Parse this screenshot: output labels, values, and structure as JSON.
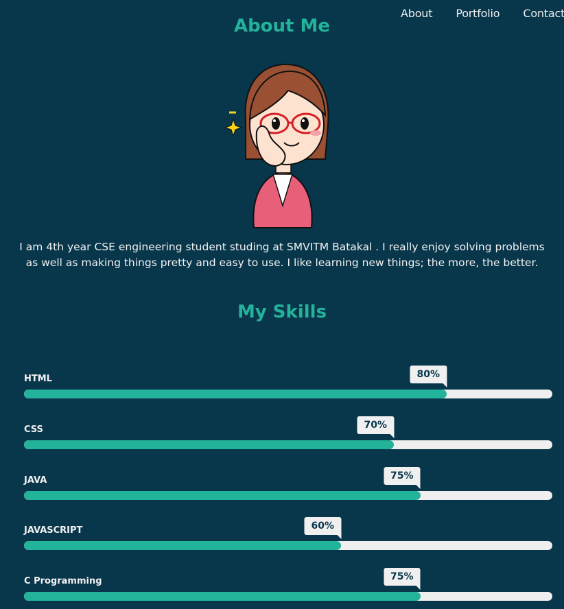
{
  "nav": {
    "about": "About",
    "portfolio": "Portfolio",
    "contact": "Contact"
  },
  "about": {
    "title": "About Me",
    "bio": "I am 4th year CSE engineering student studing at SMVITM Batakal . I really enjoy solving problems as well as making things pretty and easy to use. I like learning new things; the more, the better."
  },
  "skills": {
    "title": "My Skills",
    "items": [
      {
        "name": "HTML",
        "label": "80%",
        "value": 80
      },
      {
        "name": "CSS",
        "label": "70%",
        "value": 70
      },
      {
        "name": "JAVA",
        "label": "75%",
        "value": 75
      },
      {
        "name": "JAVASCRIPT",
        "label": "60%",
        "value": 60
      },
      {
        "name": "C Programming",
        "label": "75%",
        "value": 75
      }
    ]
  },
  "colors": {
    "background": "#08364b",
    "accent": "#23b39b",
    "track": "#efeff0"
  }
}
